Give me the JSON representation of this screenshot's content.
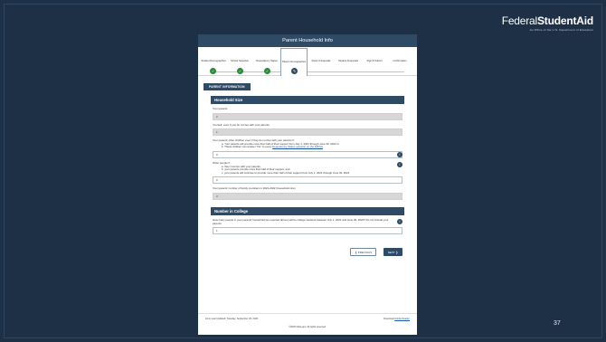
{
  "brand": {
    "name_regular": "Federal",
    "name_bold": "StudentAid",
    "subtitle": "An Office of the U.S. Department of Education"
  },
  "slide_number": "37",
  "app": {
    "title": "Parent Household Info",
    "steps": [
      {
        "label": "Student Demographics",
        "status": "done"
      },
      {
        "label": "School Selection",
        "status": "done"
      },
      {
        "label": "Dependency Status",
        "status": "done"
      },
      {
        "label": "Parent Demographics",
        "status": "current"
      },
      {
        "label": "Parent Financials",
        "status": "todo"
      },
      {
        "label": "Student Financials",
        "status": "todo"
      },
      {
        "label": "Sign & Submit",
        "status": "todo"
      },
      {
        "label": "Confirmation",
        "status": "todo"
      }
    ],
    "section_tab": "PARENT INFORMATION",
    "household": {
      "heading": "Household Size",
      "your_parents_label": "Your parents",
      "your_parents_value": "2",
      "yourself_label": "Yourself, even if you do not live with your parents",
      "yourself_value": "1",
      "other_children_label": "Your parents' other children even if they do not live with your parents if:",
      "other_children_a": "a. Your parents will provide more than half of their support from July 1, 2021 through June 30, 2022 or",
      "other_children_b_prefix": "b. These children can answer \"No\" to every",
      "other_children_b_link": "Dependency Status question on the FAFSA",
      "other_children_value": "0",
      "other_people_label": "Other people if:",
      "other_people_a": "a. they now live with your parents,",
      "other_people_b": "b. your parents provide more than half of their support, and",
      "other_people_c": "c. your parents will continue to provide more than half of their support from July 1, 2021 through June 30, 2022",
      "other_people_value": "0",
      "total_label": "Your parents' number of family members in 2021-2022 (household size)",
      "total_value": "3"
    },
    "college": {
      "heading": "Number in College",
      "question": "How many people in your parents' household (as reported above) will be college students between July 1, 2021 and June 30, 2022? Do not include your parents.",
      "value": "1"
    },
    "buttons": {
      "previous": "PREVIOUS",
      "next": "NEXT"
    },
    "footer": {
      "left": "Form Last Updated: Tuesday, September 29, 2020",
      "right_prefix": "Download",
      "right_link": "Adobe Reader",
      "center": "©2020 fafsa.gov. All rights reserved."
    }
  }
}
